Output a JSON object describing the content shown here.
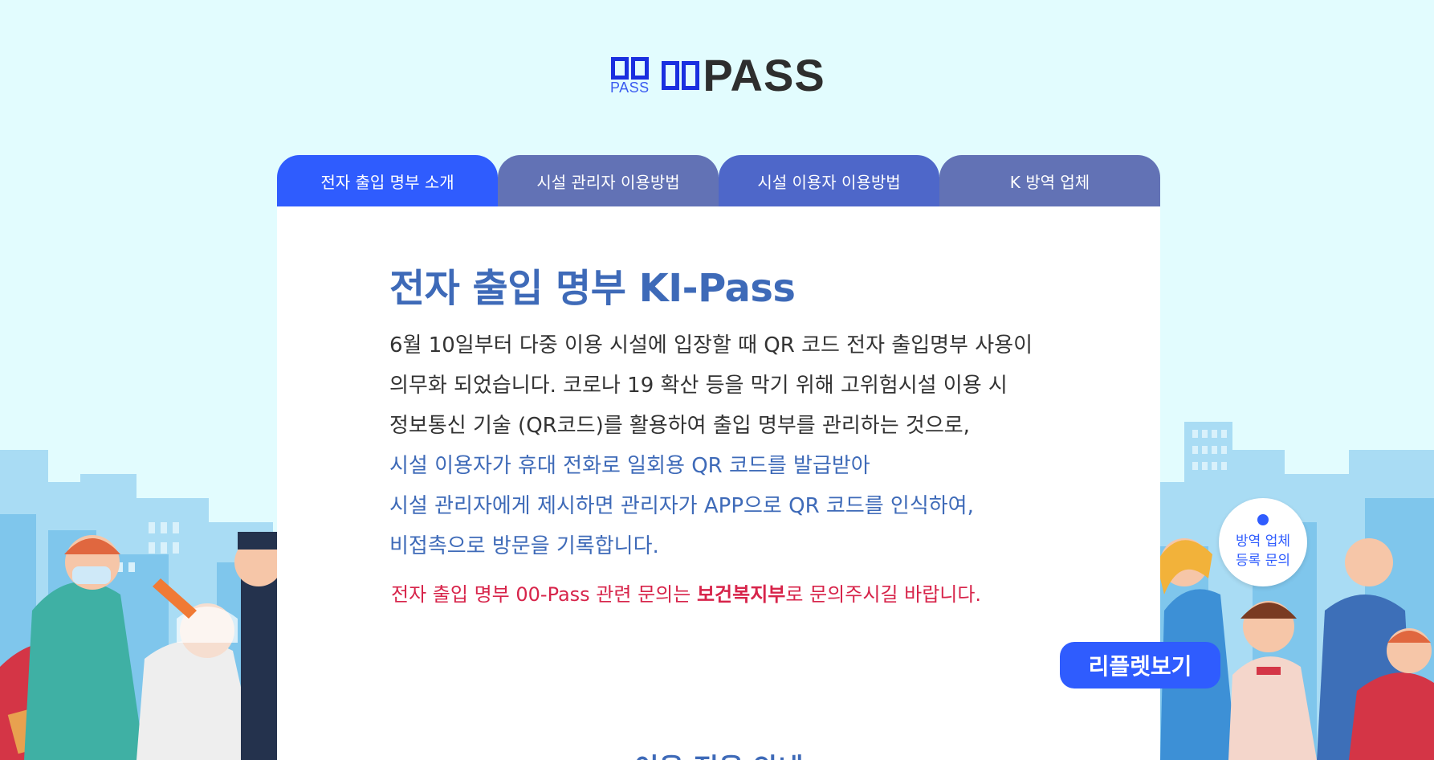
{
  "logo": {
    "mark_caption": "PASS",
    "wordmark": "PASS"
  },
  "tabs": [
    {
      "label": "전자 출입 명부 소개",
      "active": true
    },
    {
      "label": "시설 관리자 이용방법",
      "active": false
    },
    {
      "label": "시설 이용자 이용방법",
      "active": false
    },
    {
      "label": "K 방역 업체",
      "active": false
    }
  ],
  "intro": {
    "headline": "전자 출입 명부 KI-Pass",
    "lines": [
      "6월 10일부터 다중 이용 시설에 입장할 때 QR 코드 전자 출입명부 사용이",
      "의무화 되었습니다. 코로나 19 확산 등을 막기 위해 고위험시설 이용 시",
      "정보통신 기술 (QR코드)를 활용하여 출입 명부를 관리하는 것으로,",
      "시설 이용자가 휴대 전화로 일회용 QR 코드를 발급받아",
      "시설 관리자에게 제시하면 관리자가 APP으로 QR 코드를 인식하여,",
      "비접촉으로 방문을 기록합니다."
    ],
    "notice_before": "전자 출입 명부 00-Pass 관련 문의는 ",
    "notice_bold": "보건복지부",
    "notice_after": "로 문의주시길 바랍니다.",
    "leaflet_button": "리플렛보기",
    "next_heading": "이용 전용 안내"
  },
  "float_badge": {
    "line1": "방역 업체",
    "line2": "등록 문의"
  },
  "colors": {
    "background": "#e2fcfe",
    "accent": "#2f5cfe",
    "headline_blue": "#3e6ab8",
    "tab_inactive": "#6272b5",
    "notice_red": "#d7244a",
    "logo_blue": "#1a2fe0"
  }
}
